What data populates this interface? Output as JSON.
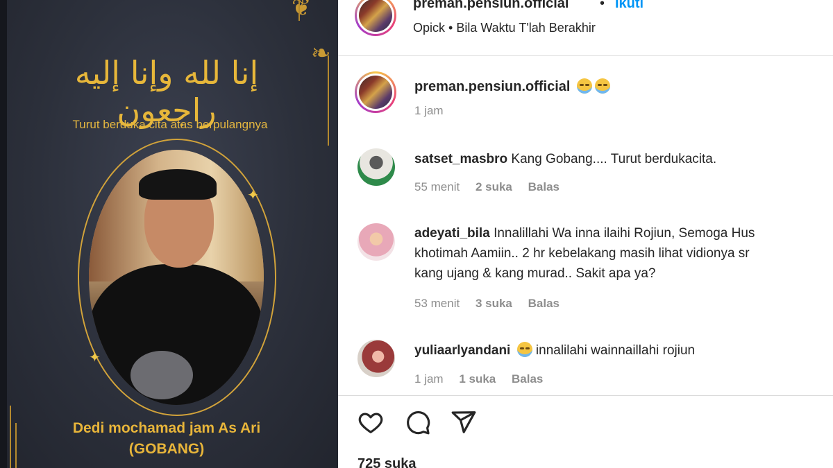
{
  "post_image": {
    "arabic": "إنا لله وإنا إليه راجعون",
    "condolence": "Turut berduka cita atas berpulangnya",
    "deceased_name": "Dedi mochamad jam As Ari",
    "nickname": "(GOBANG)"
  },
  "header": {
    "username": "preman.pensiun.official",
    "separator": "•",
    "follow_label": "Ikuti",
    "music": "Opick • Bila Waktu T'lah Berakhir"
  },
  "caption": {
    "username": "preman.pensiun.official",
    "time": "1 jam"
  },
  "comments": [
    {
      "username": "satset_masbro",
      "lines": [
        "Kang Gobang.... Turut berdukacita."
      ],
      "time": "55 menit",
      "likes": "2 suka",
      "reply": "Balas"
    },
    {
      "username": "adeyati_bila",
      "lines": [
        "Innalillahi Wa inna ilaihi Rojiun, Semoga Hus",
        "khotimah Aamiin.. 2 hr kebelakang masih lihat vidionya sr",
        "kang ujang & kang murad.. Sakit apa ya?"
      ],
      "time": "53 menit",
      "likes": "3 suka",
      "reply": "Balas"
    },
    {
      "username": "yuliaarlyandani",
      "lines": [
        "innalilahi wainnaillahi rojiun"
      ],
      "time": "1 jam",
      "likes": "1 suka",
      "reply": "Balas"
    }
  ],
  "actions": {
    "like_icon": "heart-icon",
    "comment_icon": "comment-icon",
    "share_icon": "share-icon",
    "likes_count": "725 suka"
  },
  "colors": {
    "accent_blue": "#0095f6",
    "gold": "#e8b53a",
    "card_bg": "#2c303b"
  }
}
